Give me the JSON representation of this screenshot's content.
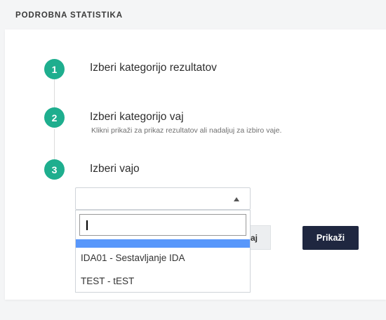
{
  "section": {
    "title": "PODROBNA STATISTIKA"
  },
  "steps": [
    {
      "number": "1",
      "title": "Izberi kategorijo rezultatov"
    },
    {
      "number": "2",
      "title": "Izberi kategorijo vaj",
      "subtitle": "Klikni prikaži za prikaz rezultatov ali nadaljuj za izbiro vaje."
    },
    {
      "number": "3",
      "title": "Izberi vajo"
    }
  ],
  "select": {
    "value": "",
    "search_value": "",
    "options": [
      "IDA01 - Sestavljanje IDA",
      "TEST - tEST"
    ]
  },
  "buttons": {
    "continue_visible": "aj",
    "show_label": "Prikaži"
  },
  "colors": {
    "accent": "#1eae8e",
    "primary_button": "#1f2740",
    "highlight": "#5897fb"
  }
}
